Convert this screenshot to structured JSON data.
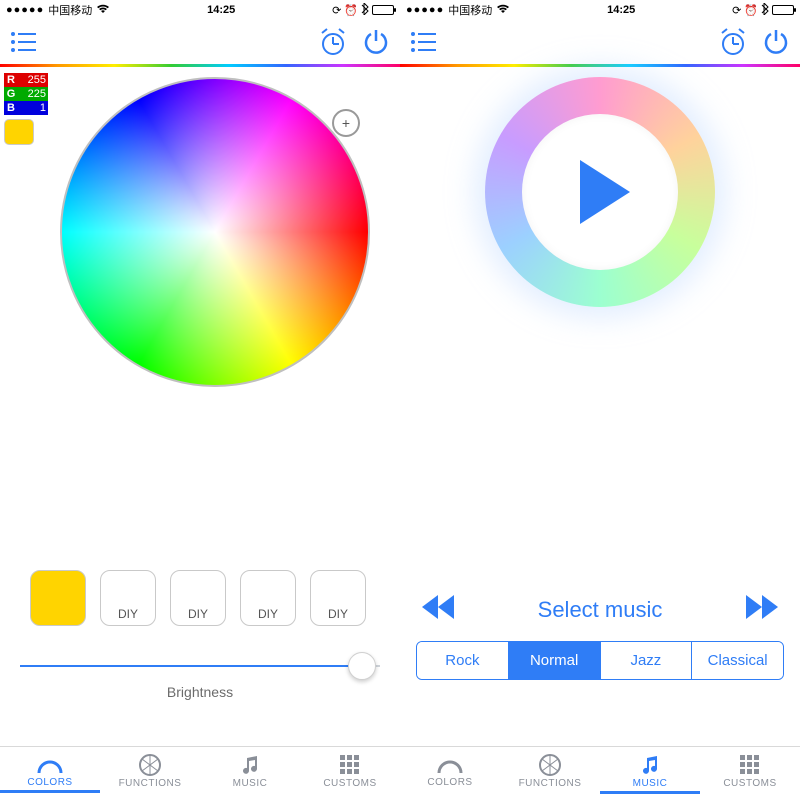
{
  "statusbar": {
    "carrier": "中国移动",
    "time": "14:25",
    "lock_icon": "lock",
    "alarm_icon": "alarm",
    "bt_icon": "bluetooth"
  },
  "nav": {
    "menu_icon": "list",
    "alarm_icon": "alarm-clock",
    "power_icon": "power"
  },
  "colors_pane": {
    "rgb": {
      "r_label": "R",
      "r": "255",
      "g_label": "G",
      "g": "225",
      "b_label": "B",
      "b": "1"
    },
    "current_swatch_hex": "#ffd400",
    "wheel_cursor_glyph": "+",
    "presets": [
      {
        "label": "",
        "color": "#ffd400"
      },
      {
        "label": "DIY",
        "color": ""
      },
      {
        "label": "DIY",
        "color": ""
      },
      {
        "label": "DIY",
        "color": ""
      },
      {
        "label": "DIY",
        "color": ""
      }
    ],
    "brightness": {
      "label": "Brightness",
      "percent": 95
    }
  },
  "music_pane": {
    "select_label": "Select music",
    "segments": [
      "Rock",
      "Normal",
      "Jazz",
      "Classical"
    ],
    "selected_segment": "Normal"
  },
  "tabs": {
    "items": [
      "COLORS",
      "FUNCTIONS",
      "MUSIC",
      "CUSTOMS"
    ],
    "left_active": "COLORS",
    "right_active": "MUSIC"
  }
}
